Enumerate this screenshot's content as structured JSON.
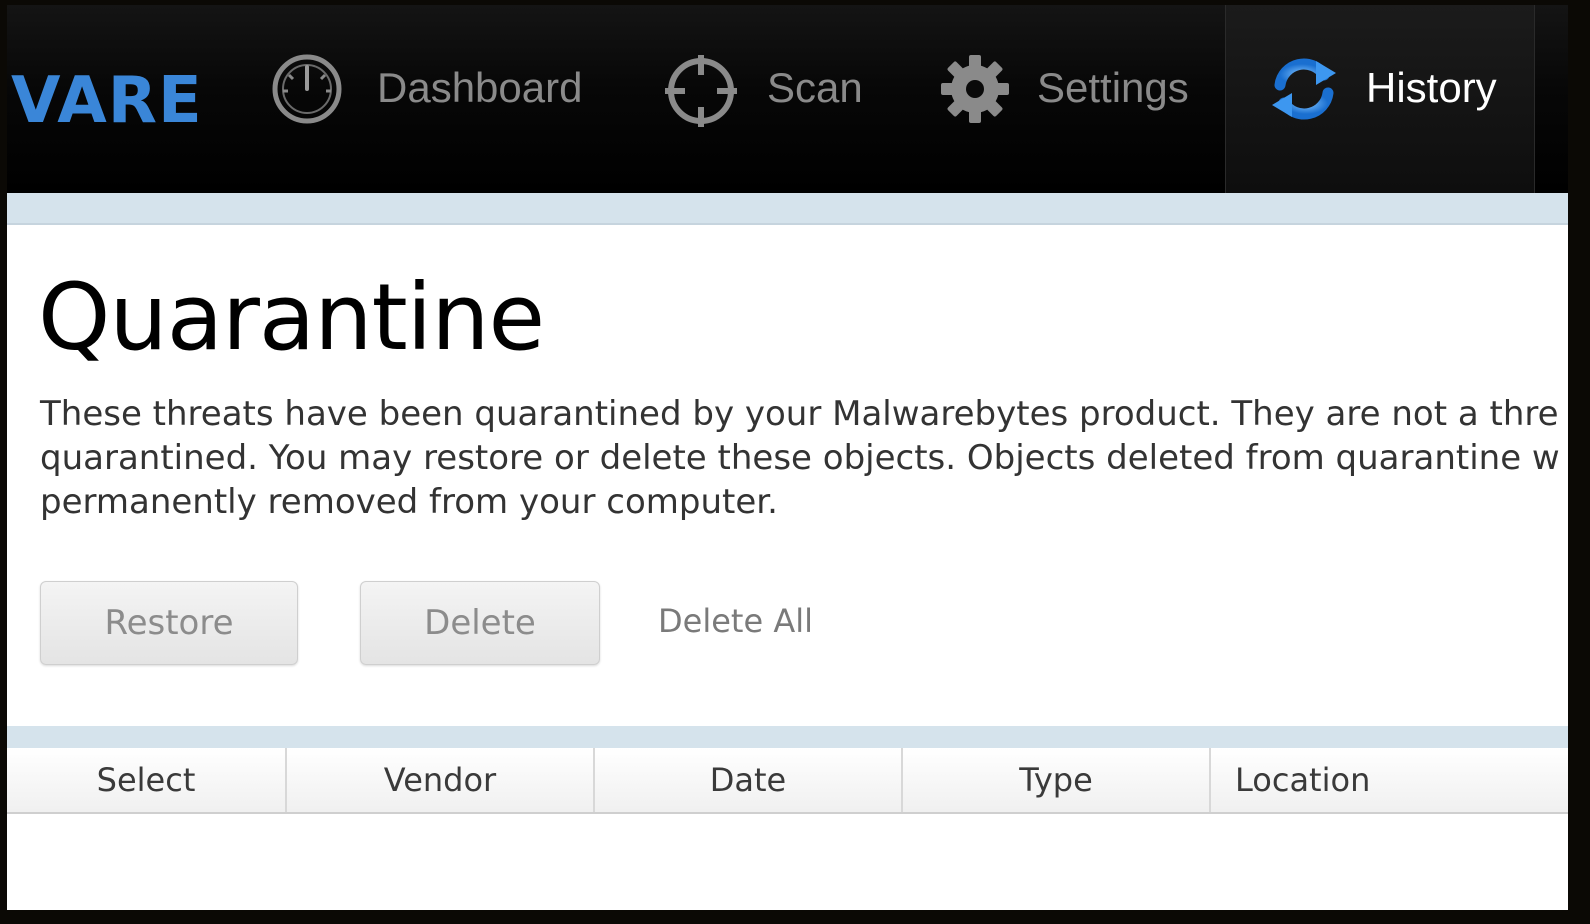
{
  "brand": {
    "text": "VARE",
    "color": "#3a86d8"
  },
  "nav": {
    "items": [
      {
        "label": "Dashboard",
        "icon": "speedometer-icon"
      },
      {
        "label": "Scan",
        "icon": "crosshair-icon"
      },
      {
        "label": "Settings",
        "icon": "gear-icon"
      },
      {
        "label": "History",
        "icon": "refresh-icon",
        "active": true
      }
    ]
  },
  "main": {
    "title": "Quarantine",
    "description_lines": [
      "These threats have been quarantined by your Malwarebytes product. They are not a thre",
      "quarantined. You may restore or delete these objects. Objects deleted from quarantine w",
      "permanently removed from your computer."
    ],
    "buttons": {
      "restore": "Restore",
      "delete": "Delete",
      "delete_all": "Delete All"
    },
    "table": {
      "columns": [
        "Select",
        "Vendor",
        "Date",
        "Type",
        "Location"
      ],
      "rows": []
    }
  },
  "colors": {
    "nav_background": "#000000",
    "accent_blue": "#3a86d8",
    "strip": "#d5e3ec"
  }
}
